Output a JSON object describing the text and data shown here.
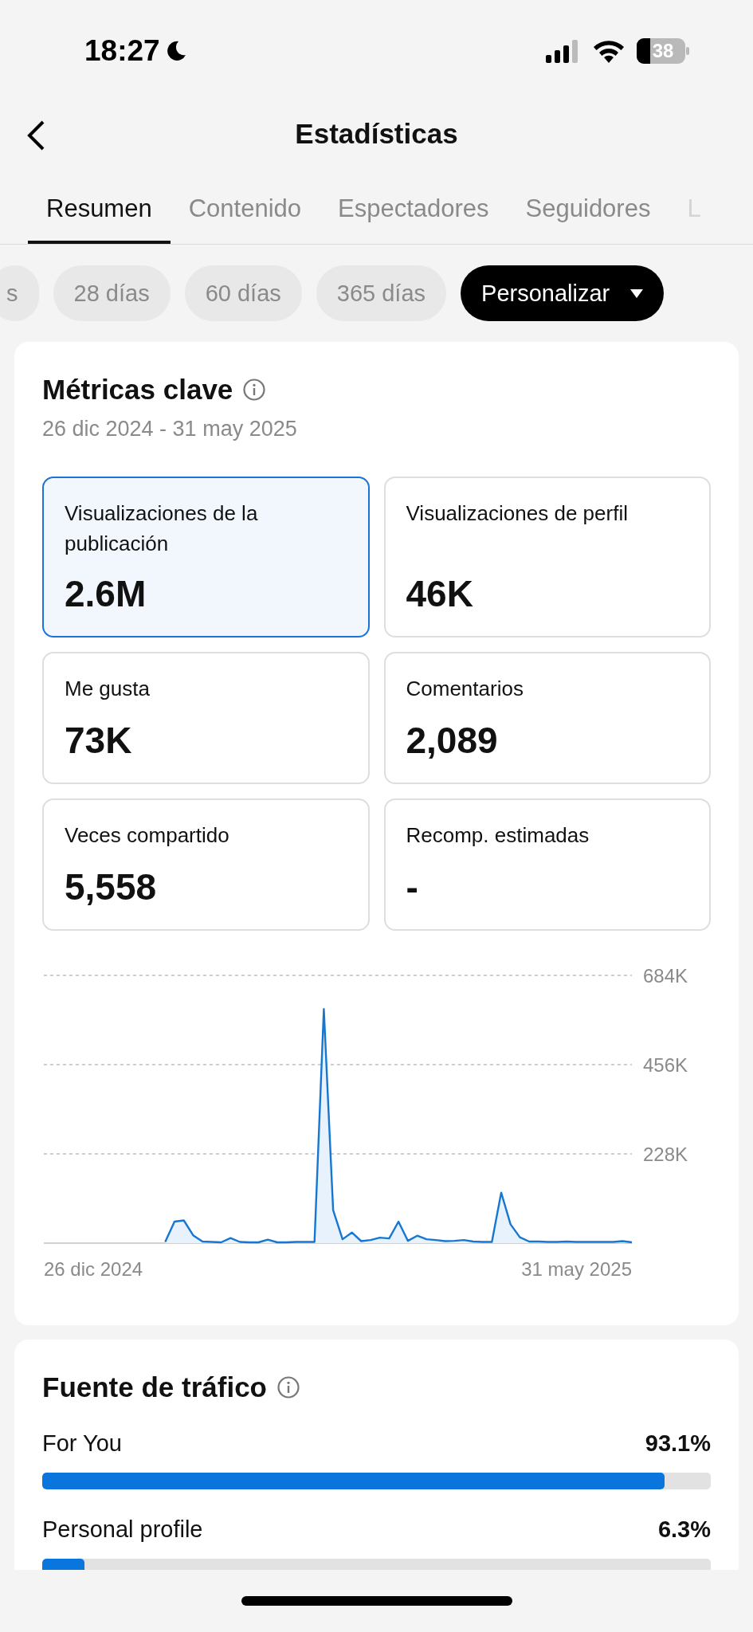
{
  "status_bar": {
    "time": "18:27",
    "battery": "38"
  },
  "header": {
    "title": "Estadísticas"
  },
  "tabs": [
    {
      "label": "Resumen",
      "selected": true
    },
    {
      "label": "Contenido",
      "selected": false
    },
    {
      "label": "Espectadores",
      "selected": false
    },
    {
      "label": "Seguidores",
      "selected": false
    },
    {
      "label": "L",
      "selected": false
    }
  ],
  "ranges": [
    {
      "label": "s",
      "kind": "preset",
      "selected": false
    },
    {
      "label": "28 días",
      "kind": "preset",
      "selected": false
    },
    {
      "label": "60 días",
      "kind": "preset",
      "selected": false
    },
    {
      "label": "365 días",
      "kind": "preset",
      "selected": false
    },
    {
      "label": "Personalizar",
      "kind": "dropdown",
      "selected": true
    }
  ],
  "key_metrics": {
    "title": "Métricas clave",
    "date_range": "26 dic 2024 - 31 may 2025",
    "tiles": [
      {
        "label": "Visualizaciones de la publicación",
        "value": "2.6M",
        "selected": true
      },
      {
        "label": "Visualizaciones de perfil",
        "value": "46K",
        "selected": false
      },
      {
        "label": "Me gusta",
        "value": "73K",
        "selected": false
      },
      {
        "label": "Comentarios",
        "value": "2,089",
        "selected": false
      },
      {
        "label": "Veces compartido",
        "value": "5,558",
        "selected": false
      },
      {
        "label": "Recomp. estimadas",
        "value": "-",
        "selected": false
      }
    ],
    "chart_data": {
      "type": "area",
      "ylim": [
        0,
        684
      ],
      "yticks": [
        {
          "value": 228,
          "label": "228K"
        },
        {
          "value": 456,
          "label": "456K"
        },
        {
          "value": 684,
          "label": "684K"
        }
      ],
      "series": [
        {
          "color": "#1677d2",
          "values": [
            null,
            null,
            null,
            null,
            null,
            null,
            null,
            null,
            null,
            null,
            null,
            null,
            null,
            3,
            55,
            58,
            20,
            4,
            3,
            2,
            13,
            3,
            2,
            2,
            9,
            2,
            2,
            3,
            3,
            3,
            598,
            84,
            10,
            27,
            5,
            8,
            14,
            12,
            55,
            6,
            19,
            10,
            8,
            5,
            6,
            8,
            4,
            3,
            3,
            129,
            48,
            15,
            4,
            4,
            3,
            3,
            4,
            3,
            3,
            3,
            3,
            3,
            5,
            2
          ]
        }
      ]
    },
    "x_axis_labels": [
      "26 dic 2024",
      "31 may 2025"
    ]
  },
  "traffic_source": {
    "title": "Fuente de tráfico",
    "sources": [
      {
        "name": "For You",
        "percent": "93.1%",
        "level": 0.931
      },
      {
        "name": "Personal profile",
        "percent": "6.3%",
        "level": 0.063
      }
    ]
  }
}
